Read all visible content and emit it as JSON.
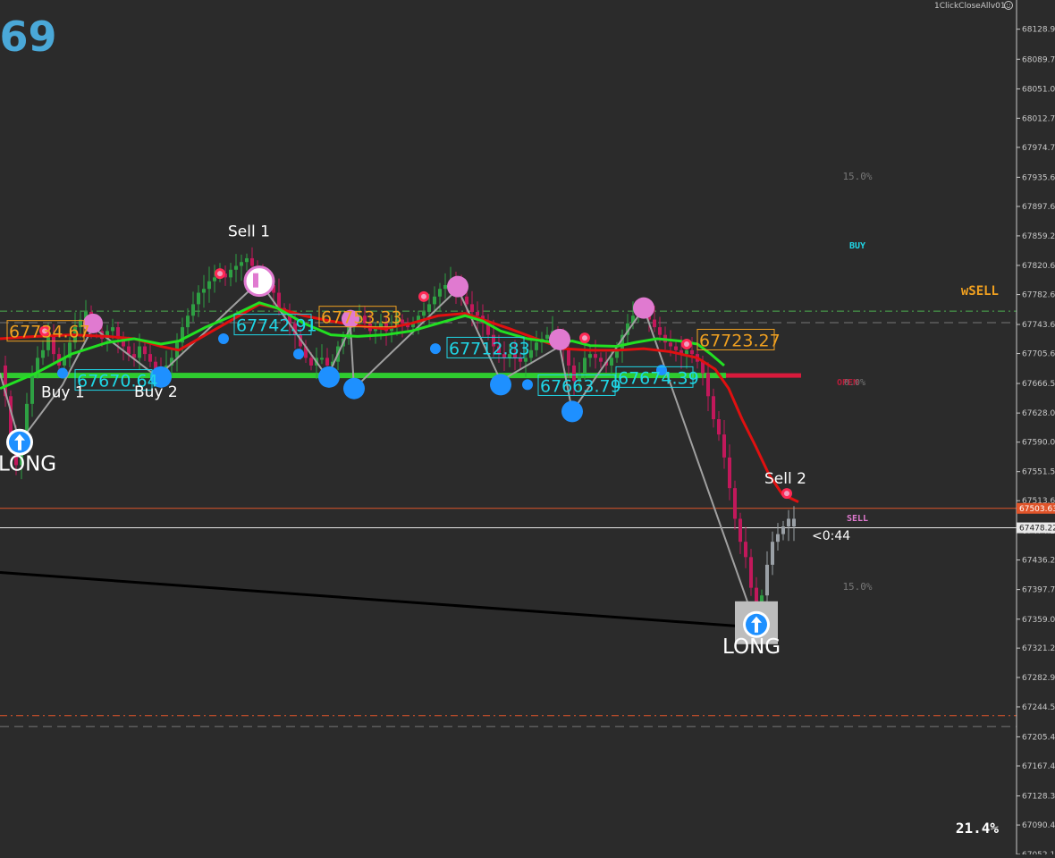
{
  "header": {
    "big_price_fragment": ".69",
    "expert_name": "1ClickCloseAllv01",
    "smiley_icon": "smiley-icon"
  },
  "colors": {
    "background": "#2b2b2b",
    "axis_text": "#c8c8c8",
    "bull": "#2ea043",
    "bear": "#c2185b",
    "ma_green": "#22e022",
    "ma_red": "#e01010",
    "cyan": "#1fd6e6",
    "orange": "#f0a020",
    "dot_blue": "#1e90ff",
    "dot_pink": "#e07ad0",
    "sell_level_red": "#d81b3c",
    "level_green": "#2fcc2f"
  },
  "chart_data": {
    "type": "candlestick",
    "ylim": [
      67052,
      68167
    ],
    "y_ticks": [
      "68128.95",
      "68089.70",
      "68051.00",
      "68012.70",
      "67974.70",
      "67935.65",
      "67897.60",
      "67859.20",
      "67820.65",
      "67782.60",
      "67743.60",
      "67705.65",
      "67666.55",
      "67628.00",
      "67590.00",
      "67551.55",
      "67513.60",
      "67474.20",
      "67436.25",
      "67397.70",
      "67359.00",
      "67321.25",
      "67282.90",
      "67244.50",
      "67205.45",
      "67167.45",
      "67128.35",
      "67090.40",
      "67052.10"
    ],
    "current_bid": "67478.22",
    "bid_tag_value": 67478.22,
    "ask_tag": "67503.63",
    "ask_value": 67503.63,
    "bar_countdown": "<0:44",
    "labels": {
      "wsell": "wSELL",
      "buy_small": "BUY",
      "sell_small": "SELL",
      "open_tag": "OPEN",
      "open_tag_overlap": "0.0%",
      "pct_top": "15.0%",
      "pct_bottom": "15.0%",
      "pct_corner": "21.4%"
    },
    "signals": [
      {
        "text": "Sell 1",
        "kind": "sell"
      },
      {
        "text": "Buy 1",
        "kind": "buy"
      },
      {
        "text": "Buy 2",
        "kind": "buy"
      },
      {
        "text": "Sell 2",
        "kind": "sell"
      },
      {
        "text": "LONG",
        "kind": "long"
      },
      {
        "text": "LONG",
        "kind": "long"
      }
    ],
    "price_boxes": [
      {
        "text": "67734.67",
        "color": "orange",
        "price": 67734.67
      },
      {
        "text": "67742.91",
        "color": "cyan",
        "price": 67742.91
      },
      {
        "text": "67753.33",
        "color": "orange",
        "price": 67753.33
      },
      {
        "text": "67712.83",
        "color": "cyan",
        "price": 67712.83
      },
      {
        "text": "67723.27",
        "color": "orange",
        "price": 67723.27
      },
      {
        "text": "67670.64",
        "color": "cyan",
        "price": 67670.64
      },
      {
        "text": "67663.79",
        "color": "cyan",
        "price": 67663.79
      },
      {
        "text": "67674.39",
        "color": "cyan",
        "price": 67674.39
      }
    ],
    "levels": {
      "open_green": 67677,
      "open_red": 67677,
      "wsell_dash": 67761,
      "upper_gray_dash": 67746,
      "lower_orange_dash": 67233,
      "lower_gray_dash": 67219
    },
    "close_path": [
      [
        0,
        67690
      ],
      [
        6,
        67650
      ],
      [
        12,
        67600
      ],
      [
        18,
        67560
      ],
      [
        24,
        67600
      ],
      [
        30,
        67640
      ],
      [
        36,
        67680
      ],
      [
        42,
        67700
      ],
      [
        48,
        67710
      ],
      [
        54,
        67730
      ],
      [
        60,
        67705
      ],
      [
        66,
        67690
      ],
      [
        72,
        67700
      ],
      [
        78,
        67720
      ],
      [
        84,
        67740
      ],
      [
        90,
        67750
      ],
      [
        96,
        67760
      ],
      [
        102,
        67745
      ],
      [
        108,
        67735
      ],
      [
        114,
        67725
      ],
      [
        120,
        67735
      ],
      [
        126,
        67740
      ],
      [
        132,
        67725
      ],
      [
        138,
        67715
      ],
      [
        144,
        67705
      ],
      [
        150,
        67700
      ],
      [
        156,
        67715
      ],
      [
        162,
        67705
      ],
      [
        168,
        67695
      ],
      [
        174,
        67685
      ],
      [
        180,
        67680
      ],
      [
        186,
        67690
      ],
      [
        192,
        67700
      ],
      [
        198,
        67720
      ],
      [
        204,
        67740
      ],
      [
        210,
        67755
      ],
      [
        216,
        67770
      ],
      [
        222,
        67785
      ],
      [
        228,
        67790
      ],
      [
        234,
        67800
      ],
      [
        240,
        67805
      ],
      [
        246,
        67810
      ],
      [
        252,
        67805
      ],
      [
        258,
        67815
      ],
      [
        264,
        67820
      ],
      [
        270,
        67825
      ],
      [
        276,
        67830
      ],
      [
        282,
        67820
      ],
      [
        288,
        67810
      ],
      [
        294,
        67800
      ],
      [
        300,
        67795
      ],
      [
        306,
        67785
      ],
      [
        312,
        67765
      ],
      [
        318,
        67755
      ],
      [
        324,
        67745
      ],
      [
        330,
        67730
      ],
      [
        336,
        67715
      ],
      [
        342,
        67700
      ],
      [
        348,
        67690
      ],
      [
        354,
        67700
      ],
      [
        360,
        67700
      ],
      [
        366,
        67690
      ],
      [
        372,
        67695
      ],
      [
        378,
        67715
      ],
      [
        384,
        67725
      ],
      [
        390,
        67740
      ],
      [
        396,
        67750
      ],
      [
        402,
        67755
      ],
      [
        408,
        67745
      ],
      [
        414,
        67735
      ],
      [
        420,
        67740
      ],
      [
        426,
        67745
      ],
      [
        432,
        67735
      ],
      [
        438,
        67740
      ],
      [
        444,
        67750
      ],
      [
        450,
        67745
      ],
      [
        456,
        67740
      ],
      [
        462,
        67745
      ],
      [
        468,
        67755
      ],
      [
        474,
        67760
      ],
      [
        480,
        67770
      ],
      [
        486,
        67780
      ],
      [
        492,
        67790
      ],
      [
        498,
        67795
      ],
      [
        504,
        67800
      ],
      [
        510,
        67790
      ],
      [
        516,
        67780
      ],
      [
        522,
        67770
      ],
      [
        528,
        67760
      ],
      [
        534,
        67755
      ],
      [
        540,
        67745
      ],
      [
        546,
        67730
      ],
      [
        552,
        67715
      ],
      [
        558,
        67705
      ],
      [
        564,
        67700
      ],
      [
        570,
        67705
      ],
      [
        576,
        67700
      ],
      [
        582,
        67695
      ],
      [
        588,
        67700
      ],
      [
        594,
        67710
      ],
      [
        600,
        67720
      ],
      [
        606,
        67725
      ],
      [
        612,
        67730
      ],
      [
        618,
        67735
      ],
      [
        624,
        67730
      ],
      [
        630,
        67710
      ],
      [
        636,
        67690
      ],
      [
        642,
        67670
      ],
      [
        648,
        67680
      ],
      [
        654,
        67700
      ],
      [
        660,
        67705
      ],
      [
        666,
        67700
      ],
      [
        672,
        67695
      ],
      [
        678,
        67690
      ],
      [
        684,
        67700
      ],
      [
        690,
        67710
      ],
      [
        696,
        67730
      ],
      [
        702,
        67745
      ],
      [
        708,
        67755
      ],
      [
        714,
        67765
      ],
      [
        720,
        67760
      ],
      [
        726,
        67750
      ],
      [
        732,
        67740
      ],
      [
        738,
        67730
      ],
      [
        744,
        67720
      ],
      [
        750,
        67715
      ],
      [
        756,
        67710
      ],
      [
        762,
        67705
      ],
      [
        768,
        67710
      ],
      [
        774,
        67705
      ],
      [
        780,
        67695
      ],
      [
        786,
        67680
      ],
      [
        792,
        67650
      ],
      [
        798,
        67620
      ],
      [
        804,
        67600
      ],
      [
        810,
        67570
      ],
      [
        816,
        67530
      ],
      [
        822,
        67490
      ],
      [
        828,
        67460
      ],
      [
        834,
        67440
      ],
      [
        840,
        67400
      ],
      [
        846,
        67375
      ],
      [
        852,
        67390
      ],
      [
        858,
        67430
      ],
      [
        864,
        67460
      ],
      [
        870,
        67470
      ],
      [
        876,
        67480
      ],
      [
        882,
        67490
      ],
      [
        888,
        67480
      ]
    ],
    "green_ma": [
      [
        0,
        67660
      ],
      [
        40,
        67680
      ],
      [
        80,
        67705
      ],
      [
        120,
        67720
      ],
      [
        150,
        67725
      ],
      [
        180,
        67718
      ],
      [
        200,
        67722
      ],
      [
        230,
        67740
      ],
      [
        260,
        67755
      ],
      [
        290,
        67772
      ],
      [
        310,
        67765
      ],
      [
        340,
        67745
      ],
      [
        370,
        67730
      ],
      [
        400,
        67728
      ],
      [
        430,
        67730
      ],
      [
        460,
        67735
      ],
      [
        490,
        67745
      ],
      [
        520,
        67755
      ],
      [
        540,
        67748
      ],
      [
        560,
        67735
      ],
      [
        590,
        67725
      ],
      [
        620,
        67720
      ],
      [
        640,
        67722
      ],
      [
        660,
        67716
      ],
      [
        690,
        67715
      ],
      [
        710,
        67720
      ],
      [
        735,
        67725
      ],
      [
        760,
        67722
      ],
      [
        780,
        67718
      ],
      [
        795,
        67705
      ],
      [
        810,
        67690
      ]
    ],
    "red_ma": [
      [
        0,
        67725
      ],
      [
        40,
        67728
      ],
      [
        80,
        67730
      ],
      [
        120,
        67728
      ],
      [
        150,
        67725
      ],
      [
        180,
        67715
      ],
      [
        200,
        67710
      ],
      [
        230,
        67730
      ],
      [
        260,
        67750
      ],
      [
        290,
        67770
      ],
      [
        310,
        67765
      ],
      [
        340,
        67755
      ],
      [
        370,
        67748
      ],
      [
        400,
        67742
      ],
      [
        430,
        67738
      ],
      [
        460,
        67745
      ],
      [
        490,
        67755
      ],
      [
        520,
        67758
      ],
      [
        540,
        67750
      ],
      [
        570,
        67738
      ],
      [
        600,
        67725
      ],
      [
        630,
        67712
      ],
      [
        660,
        67710
      ],
      [
        690,
        67710
      ],
      [
        720,
        67712
      ],
      [
        750,
        67708
      ],
      [
        780,
        67700
      ],
      [
        800,
        67685
      ],
      [
        815,
        67660
      ],
      [
        830,
        67620
      ],
      [
        845,
        67585
      ],
      [
        860,
        67548
      ],
      [
        875,
        67522
      ],
      [
        893,
        67512
      ]
    ],
    "zigzag": [
      [
        0,
        67680
      ],
      [
        22,
        67590
      ],
      [
        70,
        67665
      ],
      [
        104,
        67740
      ],
      [
        176,
        67675
      ],
      [
        290,
        67800
      ],
      [
        366,
        67675
      ],
      [
        392,
        67740
      ],
      [
        396,
        67660
      ],
      [
        512,
        67790
      ],
      [
        560,
        67670
      ],
      [
        626,
        67715
      ],
      [
        640,
        67630
      ],
      [
        720,
        67765
      ],
      [
        845,
        67352
      ]
    ],
    "blue_dots": [
      [
        22,
        67590,
        13
      ],
      [
        70,
        67680,
        6
      ],
      [
        180,
        67675,
        12
      ],
      [
        250,
        67725,
        6
      ],
      [
        334,
        67705,
        6
      ],
      [
        368,
        67675,
        12
      ],
      [
        396,
        67660,
        12
      ],
      [
        487,
        67712,
        6
      ],
      [
        560,
        67665,
        12
      ],
      [
        590,
        67665,
        6
      ],
      [
        640,
        67630,
        12
      ],
      [
        740,
        67684,
        6
      ]
    ],
    "pink_dots": [
      [
        104,
        67745,
        11
      ],
      [
        290,
        67800,
        15
      ],
      [
        392,
        67751,
        10
      ],
      [
        512,
        67793,
        12
      ],
      [
        626,
        67724,
        12
      ],
      [
        720,
        67765,
        12
      ]
    ],
    "red_dots": [
      [
        50,
        67735
      ],
      [
        246,
        67810
      ],
      [
        474,
        67780
      ],
      [
        654,
        67726
      ],
      [
        768,
        67718
      ],
      [
        880,
        67523
      ]
    ],
    "trend_line": [
      [
        0,
        67420
      ],
      [
        825,
        67350
      ]
    ]
  }
}
